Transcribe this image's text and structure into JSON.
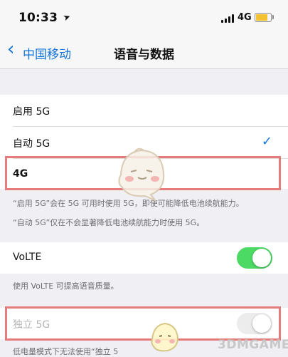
{
  "status_bar": {
    "time": "10:33",
    "network": "4G",
    "battery_color": "#f2c232"
  },
  "nav": {
    "back_label": "中国移动",
    "title": "语音与数据"
  },
  "data_options": {
    "items": [
      {
        "label": "启用 5G",
        "selected": false
      },
      {
        "label": "自动 5G",
        "selected": true
      },
      {
        "label": "4G",
        "selected": false
      }
    ],
    "footnotes": [
      "“启用 5G”会在 5G 可用时使用 5G，即使可能降低电池续航能力。",
      "“自动 5G”仅在不会显著降低电池续航能力时使用 5G。"
    ]
  },
  "volte": {
    "label": "VoLTE",
    "on": true,
    "footnote": "使用 VoLTE 可提高语音质量。"
  },
  "sa_5g": {
    "label": "独立 5G",
    "on": false,
    "footnote": "低电量模式下无法使用“独立 5"
  },
  "watermark": {
    "text": "3DMGAME"
  },
  "colors": {
    "accent": "#1474d8",
    "toggle_on": "#4cd964",
    "highlight": "#e57b7b"
  }
}
